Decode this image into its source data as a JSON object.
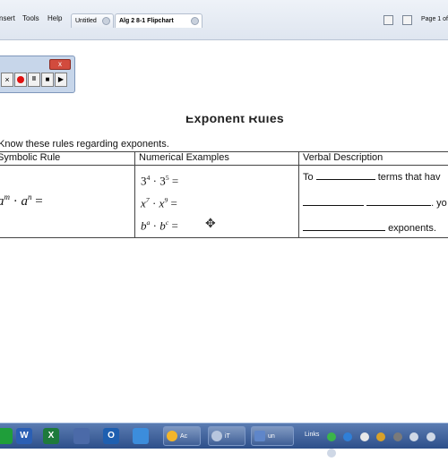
{
  "menubar": {
    "items": [
      "nsert",
      "Tools",
      "Help"
    ]
  },
  "tabs": [
    {
      "label": "Untitled",
      "active": false
    },
    {
      "label": "Alg 2 8-1 Flipchart",
      "active": true
    }
  ],
  "page_indicator": "Page 1 of",
  "recorder": {
    "close_label": "x",
    "buttons": [
      "×",
      "●",
      "II",
      "■",
      "▶"
    ]
  },
  "document": {
    "title": "Exponent Rules",
    "instruction": "Know these rules regarding exponents.",
    "table": {
      "headers": [
        "Symbolic Rule",
        "Numerical Examples",
        "Verbal Description"
      ],
      "rule": {
        "base": "a",
        "exp1": "m",
        "exp2": "n",
        "tail": " ="
      },
      "examples": [
        {
          "b1": "3",
          "e1": "4",
          "b2": "3",
          "e2": "5"
        },
        {
          "b1": "x",
          "e1": "7",
          "b2": "x",
          "e2": "9"
        },
        {
          "b1": "b",
          "e1": "a",
          "b2": "b",
          "e2": "c"
        }
      ],
      "verbal": {
        "line1_start": "To",
        "line1_end": "terms that hav",
        "line2_end": ". yo",
        "line3_end": "exponents."
      }
    }
  },
  "taskbar": {
    "buttons": [
      "Ac",
      "iT",
      "un"
    ],
    "links_label": "Links"
  },
  "colors": {
    "accent_blue": "#2d4f8a",
    "record_red": "#e01010"
  }
}
